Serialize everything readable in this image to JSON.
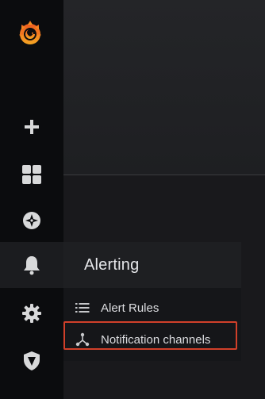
{
  "sidebar": {
    "logo_icon": "grafana-logo-icon",
    "items": [
      {
        "icon": "plus-icon",
        "name": "create"
      },
      {
        "icon": "dashboards-grid-icon",
        "name": "dashboards"
      },
      {
        "icon": "compass-icon",
        "name": "explore"
      },
      {
        "icon": "bell-icon",
        "name": "alerting",
        "active": true
      },
      {
        "icon": "gear-icon",
        "name": "configuration"
      },
      {
        "icon": "shield-icon",
        "name": "server-admin"
      }
    ]
  },
  "flyout": {
    "title": "Alerting",
    "items": [
      {
        "label": "Alert Rules",
        "icon": "list-icon"
      },
      {
        "label": "Notification channels",
        "icon": "share-nodes-icon",
        "highlighted": true
      }
    ]
  },
  "colors": {
    "sidebar_bg": "#0b0c0e",
    "highlight": "#d1402a",
    "logo_orange": "#f28a1a"
  }
}
